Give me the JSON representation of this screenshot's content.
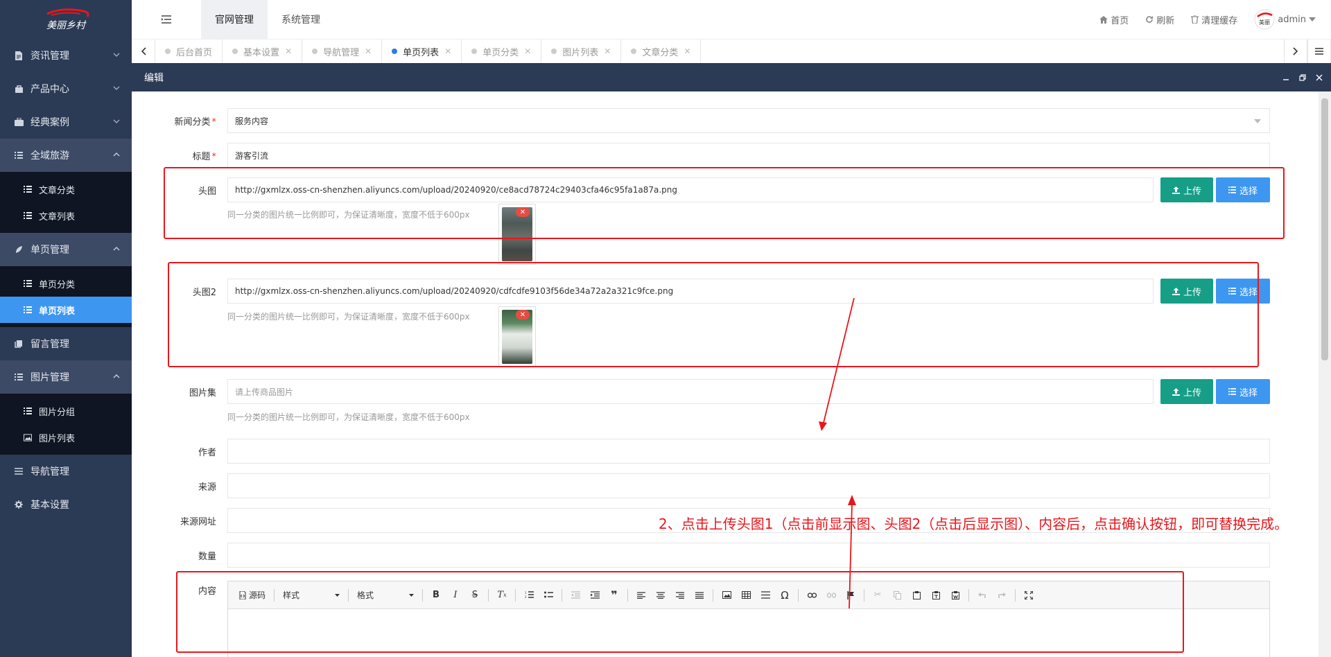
{
  "app": {
    "logo_text": "美丽乡村"
  },
  "sidebar": {
    "groups": [
      {
        "label": "资讯管理",
        "icon": "document-icon"
      },
      {
        "label": "产品中心",
        "icon": "bag-icon"
      },
      {
        "label": "经典案例",
        "icon": "briefcase-icon"
      },
      {
        "label": "全域旅游",
        "icon": "list-icon",
        "items": [
          "文章分类",
          "文章列表"
        ]
      },
      {
        "label": "单页管理",
        "icon": "leaf-icon",
        "items": [
          "单页分类",
          "单页列表"
        ]
      },
      {
        "label": "留言管理",
        "icon": "book-icon"
      },
      {
        "label": "图片管理",
        "icon": "list-icon",
        "items": [
          "图片分组",
          "图片列表"
        ]
      },
      {
        "label": "导航管理",
        "icon": "menu-icon"
      },
      {
        "label": "基本设置",
        "icon": "gear-icon"
      }
    ],
    "active_item": "单页列表"
  },
  "topbar": {
    "tabs": [
      "官网管理",
      "系统管理"
    ],
    "active_tab": "官网管理",
    "home": "首页",
    "refresh": "刷新",
    "clear_cache": "清理缓存",
    "user": "admin"
  },
  "page_tabs": {
    "items": [
      "后台首页",
      "基本设置",
      "导航管理",
      "单页列表",
      "单页分类",
      "图片列表",
      "文章分类"
    ],
    "active": "单页列表"
  },
  "panel": {
    "title": "编辑"
  },
  "form": {
    "category": {
      "label": "新闻分类",
      "value": "服务内容"
    },
    "title": {
      "label": "标题",
      "value": "游客引流"
    },
    "image1": {
      "label": "头图",
      "value": "http://gxmlzx.oss-cn-shenzhen.aliyuncs.com/upload/20240920/ce8acd78724c29403cfa46c95fa1a87a.png",
      "hint": "同一分类的图片统一比例即可，为保证清晰度，宽度不低于600px"
    },
    "image2": {
      "label": "头图2",
      "value": "http://gxmlzx.oss-cn-shenzhen.aliyuncs.com/upload/20240920/cdfcdfe9103f56de34a72a2a321c9fce.png",
      "hint": "同一分类的图片统一比例即可，为保证清晰度，宽度不低于600px"
    },
    "gallery": {
      "label": "图片集",
      "placeholder": "请上传商品图片",
      "hint": "同一分类的图片统一比例即可，为保证清晰度，宽度不低于600px"
    },
    "author": {
      "label": "作者",
      "value": ""
    },
    "source": {
      "label": "来源",
      "value": ""
    },
    "source_url": {
      "label": "来源网址",
      "value": ""
    },
    "quantity": {
      "label": "数量",
      "value": ""
    },
    "content": {
      "label": "内容"
    },
    "upload_label": "上传",
    "select_label": "选择"
  },
  "editor": {
    "source_label": "源码",
    "style_label": "样式",
    "format_label": "格式"
  },
  "annotation": {
    "text": "2、点击上传头图1（点击前显示图、头图2（点击后显示图）、内容后，点击确认按钮，即可替换完成。",
    "color": "#e8161b"
  }
}
